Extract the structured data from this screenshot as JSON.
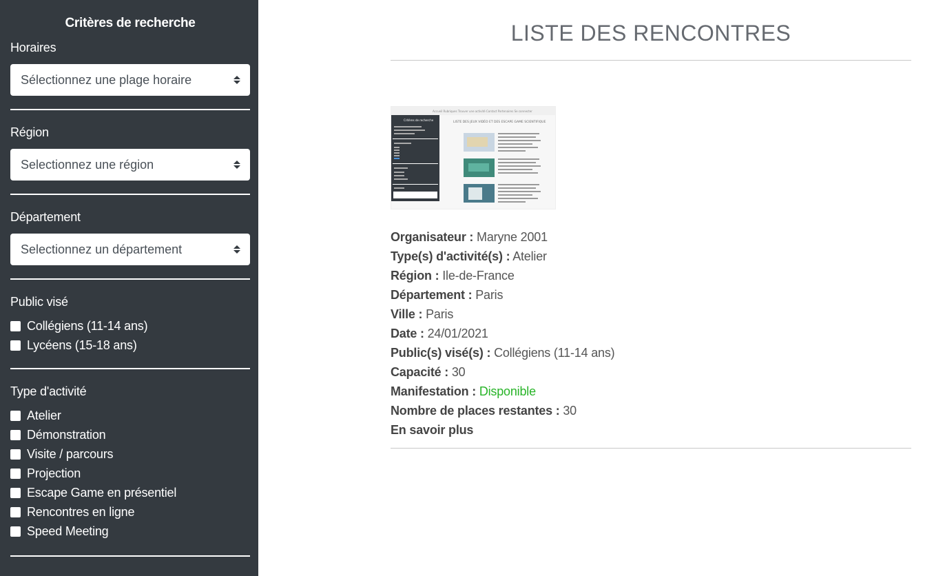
{
  "sidebar": {
    "title": "Critères de recherche",
    "horaires": {
      "label": "Horaires",
      "select": "Sélectionnez une plage horaire"
    },
    "region": {
      "label": "Région",
      "select": "Selectionnez une région"
    },
    "departement": {
      "label": "Département",
      "select": "Selectionnez un département"
    },
    "public": {
      "label": "Public visé",
      "options": [
        "Collégiens (11-14 ans)",
        "Lycéens (15-18 ans)"
      ]
    },
    "activite": {
      "label": "Type d'activité",
      "options": [
        "Atelier",
        "Démonstration",
        "Visite / parcours",
        "Projection",
        "Escape Game en présentiel",
        "Rencontres en ligne",
        "Speed Meeting"
      ]
    }
  },
  "main": {
    "title": "LISTE DES RENCONTRES",
    "thumbnail": {
      "nav": "Accueil   Rubriques   Trouver une activité   Contact   Partenaires   Se connecter",
      "title": "LISTE DES JEUX VIDÉO ET DES ESCAPE GAME SCIENTIFIQUE",
      "sidebar_title": "Critères de recherche"
    },
    "fields": [
      {
        "label": "Organisateur :",
        "value": "Maryne 2001"
      },
      {
        "label": "Type(s) d'activité(s) :",
        "value": "Atelier"
      },
      {
        "label": "Région :",
        "value": "Ile-de-France"
      },
      {
        "label": "Département :",
        "value": "Paris"
      },
      {
        "label": "Ville :",
        "value": "Paris"
      },
      {
        "label": "Date :",
        "value": "24/01/2021"
      },
      {
        "label": "Public(s) visé(s) :",
        "value": "Collégiens (11-14 ans)"
      },
      {
        "label": "Capacité :",
        "value": "30"
      },
      {
        "label": "Manifestation :",
        "value": "Disponible"
      },
      {
        "label": "Nombre de places restantes :",
        "value": "30"
      }
    ],
    "more_label": "En savoir plus"
  },
  "colors": {
    "sidebar_bg": "#343a40",
    "available": "#28b428"
  }
}
